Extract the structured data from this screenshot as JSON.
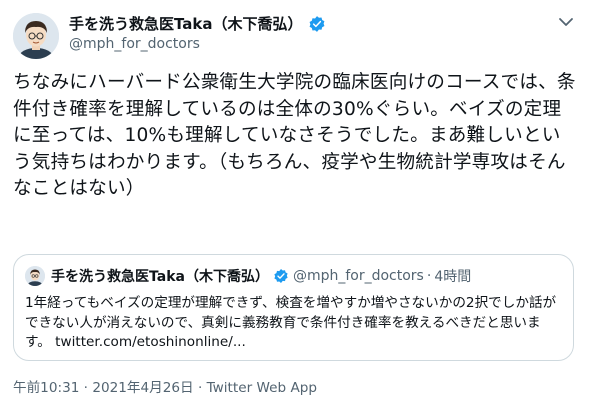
{
  "author": {
    "display_name": "手を洗う救急医Taka（木下喬弘）",
    "handle": "@mph_for_doctors"
  },
  "tweet": {
    "text": "ちなみにハーバード公衆衛生大学院の臨床医向けのコースでは、条件付き確率を理解しているのは全体の30%ぐらい。ベイズの定理に至っては、10%も理解していなさそうでした。まあ難しいという気持ちはわかります。（もちろん、疫学や生物統計学専攻はそんなことはない）"
  },
  "quoted_tweet": {
    "display_name": "手を洗う救急医Taka（木下喬弘）",
    "handle": "@mph_for_doctors",
    "separator": "·",
    "time": "4時間",
    "text": "1年経ってもベイズの定理が理解できず、検査を増やすか増やさないかの2択でしか話ができない人が消えないので、真剣に義務教育で条件付き確率を教えるべきだと思います。",
    "link": "twitter.com/etoshinonline/..."
  },
  "footer": {
    "meta": "午前10:31 · 2021年4月26日 · Twitter Web App"
  },
  "icons": {
    "verified": "verified-badge-icon",
    "more": "chevron-down-icon"
  },
  "colors": {
    "verified": "#1d9bf0",
    "secondary_text": "#536471",
    "border": "#cfd9de"
  }
}
